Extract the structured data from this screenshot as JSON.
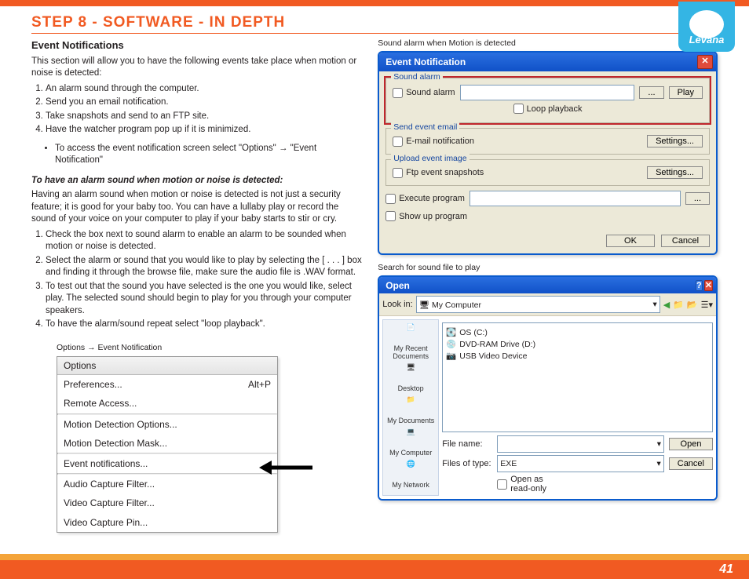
{
  "page_title": "STEP 8   - SOFTWARE - IN DEPTH",
  "section_heading": "Event Notifications",
  "intro": "This section will allow you to have the following events take place when motion or noise is detected:",
  "intro_list": [
    "An alarm sound through the computer.",
    "Send you an email notification.",
    "Take snapshots and send to an FTP site.",
    "Have the watcher program pop up if it is minimized."
  ],
  "intro_bullet": "To access the event notification screen select \"Options\" → \"Event Notification\"",
  "alarm_heading": "To have an alarm sound when motion or noise is detected:",
  "alarm_para": "Having an alarm sound when motion or noise is detected is not just a security feature; it is good for your baby too. You can have a lullaby play or record the sound of your voice on your computer to play if your baby starts to stir or cry.",
  "alarm_list": [
    "Check the box next to sound alarm to enable an alarm to be sounded when motion or noise is detected.",
    "Select the alarm or sound that you would like to play by selecting the [ . . . ] box and finding it through the browse file, make sure the audio file is .WAV format.",
    "To test out that the sound you have selected is the one you would like, select play. The selected sound should begin to play for you through your computer speakers.",
    "To have the alarm/sound repeat select \"loop playback\"."
  ],
  "options_caption": "Options → Event Notification",
  "options_menu": {
    "title": "Options",
    "items": [
      {
        "label": "Preferences...",
        "shortcut": "Alt+P"
      },
      {
        "label": "Remote Access..."
      },
      {
        "label": "Motion Detection Options..."
      },
      {
        "label": "Motion Detection Mask..."
      },
      {
        "label": "Event notifications..."
      },
      {
        "label": "Audio Capture Filter..."
      },
      {
        "label": "Video Capture Filter..."
      },
      {
        "label": "Video Capture Pin..."
      }
    ]
  },
  "dialog1_caption": "Sound alarm when Motion is detected",
  "dialog1": {
    "title": "Event Notification",
    "sound_group": "Sound alarm",
    "sound_alarm": "Sound alarm",
    "loop": "Loop playback",
    "browse": "...",
    "play": "Play",
    "email_group": "Send event email",
    "email_chk": "E-mail notification",
    "settings": "Settings...",
    "upload_group": "Upload event image",
    "ftp_chk": "Ftp event snapshots",
    "execute": "Execute program",
    "showup": "Show up program",
    "ok": "OK",
    "cancel": "Cancel"
  },
  "dialog2_caption": "Search for sound file to play",
  "dialog2": {
    "title": "Open",
    "lookin_label": "Look in:",
    "lookin_value": "My Computer",
    "files": [
      "OS (C:)",
      "DVD-RAM Drive (D:)",
      "USB Video Device"
    ],
    "places": [
      "My Recent Documents",
      "Desktop",
      "My Documents",
      "My Computer",
      "My Network"
    ],
    "filename_label": "File name:",
    "filename_value": "",
    "filetype_label": "Files of type:",
    "filetype_value": "EXE",
    "readonly": "Open as read-only",
    "open": "Open",
    "cancel": "Cancel"
  },
  "page_number": "41",
  "brand": "Levana"
}
